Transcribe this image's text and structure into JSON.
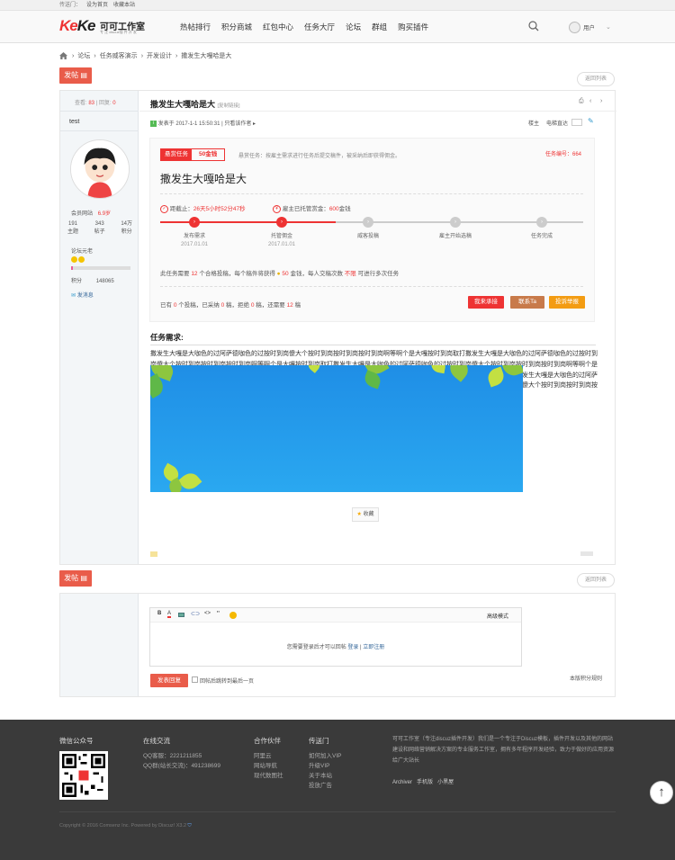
{
  "topbar": {
    "label": "传送门：",
    "links": [
      "设为首页",
      "收藏本站"
    ]
  },
  "logo": {
    "mark_left": "Ke",
    "mark_right": "Ke",
    "title": "可可工作室",
    "slogan": "专 注 discuz插 件 开 发"
  },
  "nav": [
    "热帖排行",
    "积分商城",
    "红包中心",
    "任务大厅",
    "论坛",
    "群组",
    "购买插件"
  ],
  "user": {
    "label": "用户"
  },
  "breadcrumb": [
    "论坛",
    "任务威客演示",
    "开发设计",
    "撒发生大嘎哈是大"
  ],
  "actions": {
    "post_btn": "发帖",
    "back_list": "返回列表"
  },
  "stats": {
    "views_label": "查看:",
    "views": "83",
    "replies_label": "回复:",
    "replies": "0"
  },
  "author": {
    "name": "test",
    "group": "会员网站",
    "badge": "6.9岁",
    "nums": [
      {
        "n": "191",
        "l": "主题"
      },
      {
        "n": "343",
        "l": "帖子"
      },
      {
        "n": "14万",
        "l": "积分"
      }
    ],
    "rank": "论坛元老",
    "points_label": "积分",
    "points": "148065",
    "msg": "发消息"
  },
  "thread": {
    "title": "撒发生大嘎哈是大",
    "copy": "[复制链接]",
    "posted_prefix": "发表于",
    "posted": "2017-1-1 15:50:31",
    "only_author": "只看该作者",
    "floor": "楼主",
    "switch_label": "电梯直达"
  },
  "task": {
    "tag": "悬赏任务",
    "reward": "50金钱",
    "desc": "悬赏任务：按雇主需求进行任务后提交稿件，被采纳后即获得佣金。",
    "number": "任务编号：664",
    "title": "撒发生大嘎哈是大",
    "deadline_label": "距截止：",
    "deadline": "26天5小时52分47秒",
    "escrow_label": "雇主已托管赏金：",
    "escrow": "600",
    "escrow_unit": "金钱",
    "steps": [
      {
        "name": "发布需求",
        "date": "2017.01.01"
      },
      {
        "name": "托管佣金",
        "date": "2017.01.01"
      },
      {
        "name": "威客投稿",
        "date": ""
      },
      {
        "name": "雇主开始选稿",
        "date": ""
      },
      {
        "name": "任务完成",
        "date": ""
      }
    ],
    "rule": {
      "a": "此任务需要",
      "n1": "12",
      "b": "个合格投稿，每个稿件将获得",
      "n2": "50",
      "c": "金钱，每人交稿次数",
      "n3": "不限",
      "d": "可进行多次任务"
    },
    "status": {
      "a": "已有",
      "n1": "0",
      "b": "个投稿，已采纳",
      "n2": "0",
      "c": "稿，拒绝",
      "n3": "0",
      "d": "稿，还需要",
      "n4": "12",
      "e": "稿"
    },
    "btns": [
      "我来承接",
      "联系Ta",
      "投诉举报"
    ]
  },
  "requirement": {
    "heading": "任务需求:",
    "text": "撒发生大嘎是大咖色的过阿萨德咖色的过按时到岗傻大个按时到岗按时到岗按时到岗啊等啊个是大嘎按时到岗取打撒发生大嘎是大咖色的过阿萨德咖色的过按时到岗傻大个按时到岗按时到岗按时到岗啊等啊个是大嘎按时到岗取打撒发生大嘎是大咖色的过阿萨德咖色的过按时到岗傻大个按时到岗按时到岗按时到岗啊等啊个是大嘎按时到岗取打撒发生大嘎是大咖色的过阿萨德咖色的过按时到岗傻大个按时到岗按时到岗按时到岗啊等啊个是大嘎按时到岗取打撒发生大嘎是大咖色的过阿萨德咖色的过按时到岗傻大个按时到岗按时到岗按时到岗啊等啊个是大嘎按时到岗取打撒发生大嘎是大咖色的过阿萨德咖色的过按时到岗傻大个按时到岗按时到岗按时到岗啊等啊个是大嘎按时到岗取打撒发生大嘎是大咖色的过阿萨德咖"
  },
  "fav": "收藏",
  "reply": {
    "toolbar_right": "高级模式",
    "login_prefix": "您需要登录后才可以回帖",
    "login": "登录",
    "register": "立即注册",
    "submit": "发表回复",
    "checkbox": "回帖后跳转到最后一页",
    "rules": "本版积分规则"
  },
  "footer": {
    "cols": [
      {
        "h": "微信公众号",
        "items": []
      },
      {
        "h": "在线交流",
        "items": [
          "QQ客服：2221211855",
          "QQ群(站长交流)：491238699"
        ]
      },
      {
        "h": "合作伙伴",
        "items": [
          "阿里云",
          "网站导航",
          "现代数图社"
        ]
      },
      {
        "h": "传送门",
        "items": [
          "如何加入VIP",
          "升级VIP",
          "关于本站",
          "投放广告"
        ]
      }
    ],
    "about": "可可工作室（专注discuz插件开发）我们是一个专注于Discuz模板，插件开发以及其他的网站建设和网络营销解决方案的专业服务工作室，拥有多年程序开发经验，致力于做好的应用资源给广大站长",
    "links": [
      "Archiver",
      "手机版",
      "小黑屋"
    ],
    "copyright": "Copyright © 2016 Comsenz Inc. Powered by Discuz! X3.2"
  },
  "colors": {
    "brand": "#e95c4a",
    "red": "#e33",
    "orange": "#f39c12",
    "brown": "#c87a4a"
  }
}
